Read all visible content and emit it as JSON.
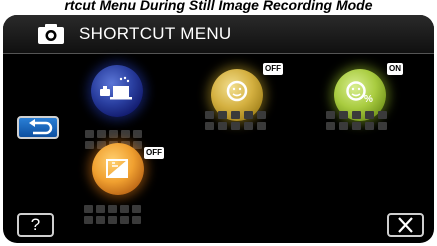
{
  "caption": "rtcut Menu During Still Image Recording Mode",
  "header": {
    "title": "SHORTCUT MENU",
    "mode_icon": "camera-icon"
  },
  "menu_items": [
    {
      "icon": "scene-select-icon",
      "color": "#2a3fa0",
      "label": "•••••",
      "state": ""
    },
    {
      "icon": "face-priority-icon",
      "color": "#d4b040",
      "label": "•••••",
      "state": "OFF"
    },
    {
      "icon": "smile-shot-icon",
      "color": "#a9cc40",
      "label": "•••••",
      "state": "ON"
    },
    {
      "icon": "backlight-compensation-icon",
      "color": "#f0a030",
      "label": "•••••",
      "state": "OFF"
    }
  ],
  "buttons": {
    "back_icon": "return-arrow-icon",
    "help_label": "?",
    "close_icon": "close-icon"
  }
}
